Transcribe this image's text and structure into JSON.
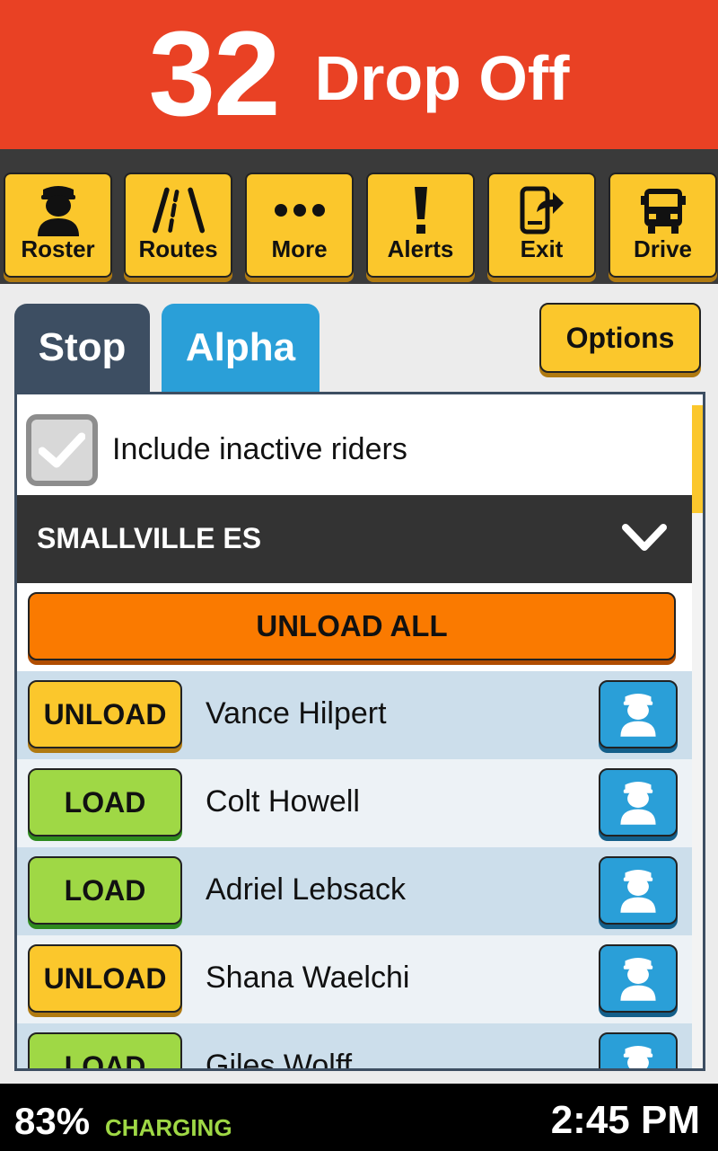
{
  "header": {
    "stop_number": "32",
    "stop_type": "Drop Off",
    "color": "#e94124"
  },
  "toolbar": {
    "buttons": [
      {
        "label": "Roster",
        "icon": "person-icon"
      },
      {
        "label": "Routes",
        "icon": "road-icon"
      },
      {
        "label": "More",
        "icon": "more-dots-icon"
      },
      {
        "label": "Alerts",
        "icon": "exclamation-icon"
      },
      {
        "label": "Exit",
        "icon": "phone-exit-icon"
      },
      {
        "label": "Drive",
        "icon": "bus-icon"
      }
    ]
  },
  "tabs": [
    {
      "label": "Stop",
      "selected": true
    },
    {
      "label": "Alpha",
      "selected": false
    }
  ],
  "options_label": "Options",
  "include_inactive": {
    "label": "Include inactive riders",
    "checked": false
  },
  "school": {
    "name": "SMALLVILLE ES"
  },
  "unload_all_label": "UNLOAD ALL",
  "riders": [
    {
      "action": "UNLOAD",
      "name": "Vance Hilpert"
    },
    {
      "action": "LOAD",
      "name": "Colt Howell"
    },
    {
      "action": "LOAD",
      "name": "Adriel Lebsack"
    },
    {
      "action": "UNLOAD",
      "name": "Shana Waelchi"
    },
    {
      "action": "LOAD",
      "name": "Giles Wolff"
    }
  ],
  "status": {
    "battery": "83%",
    "charging": "CHARGING",
    "time": "2:45 PM"
  },
  "colors": {
    "yellow": "#fbc72c",
    "green": "#9fd845",
    "blue": "#2a9fd8",
    "orange": "#fa7a00"
  }
}
